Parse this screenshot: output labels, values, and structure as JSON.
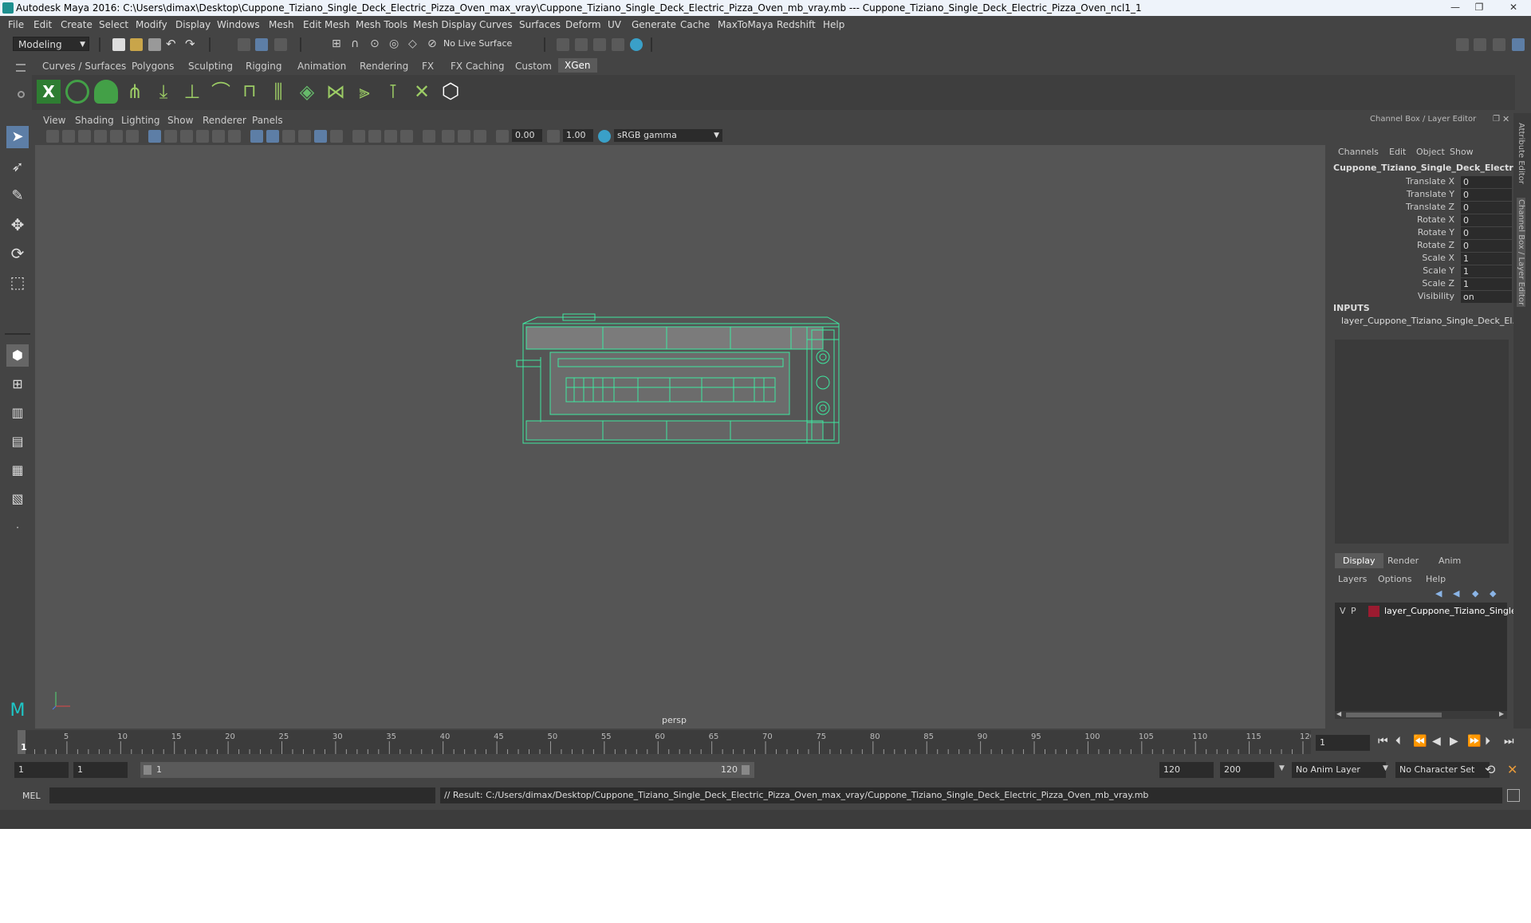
{
  "window": {
    "title": "Autodesk Maya 2016: C:\\Users\\dimax\\Desktop\\Cuppone_Tiziano_Single_Deck_Electric_Pizza_Oven_max_vray\\Cuppone_Tiziano_Single_Deck_Electric_Pizza_Oven_mb_vray.mb   ---   Cuppone_Tiziano_Single_Deck_Electric_Pizza_Oven_ncl1_1",
    "minimize": "—",
    "maximize": "❐",
    "close": "✕"
  },
  "menubar": [
    "File",
    "Edit",
    "Create",
    "Select",
    "Modify",
    "Display",
    "Windows",
    "Mesh",
    "Edit Mesh",
    "Mesh Tools",
    "Mesh Display",
    "Curves",
    "Surfaces",
    "Deform",
    "UV",
    "Generate",
    "Cache",
    "MaxToMaya",
    "Redshift",
    "Help"
  ],
  "statusline": {
    "mode": "Modeling",
    "live_surface": "No Live Surface"
  },
  "shelf_tabs": [
    "Curves / Surfaces",
    "Polygons",
    "Sculpting",
    "Rigging",
    "Animation",
    "Rendering",
    "FX",
    "FX Caching",
    "Custom",
    "XGen"
  ],
  "shelf_active": "XGen",
  "viewport": {
    "menu": [
      "View",
      "Shading",
      "Lighting",
      "Show",
      "Renderer",
      "Panels"
    ],
    "field_a": "0.00",
    "field_b": "1.00",
    "color_space": "sRGB gamma",
    "camera": "persp"
  },
  "channel_box": {
    "header": "Channel Box / Layer Editor",
    "menu": [
      "Channels",
      "Edit",
      "Object",
      "Show"
    ],
    "object_name": "Cuppone_Tiziano_Single_Deck_Electric_P...",
    "attributes": [
      {
        "name": "Translate X",
        "value": "0"
      },
      {
        "name": "Translate Y",
        "value": "0"
      },
      {
        "name": "Translate Z",
        "value": "0"
      },
      {
        "name": "Rotate X",
        "value": "0"
      },
      {
        "name": "Rotate Y",
        "value": "0"
      },
      {
        "name": "Rotate Z",
        "value": "0"
      },
      {
        "name": "Scale X",
        "value": "1"
      },
      {
        "name": "Scale Y",
        "value": "1"
      },
      {
        "name": "Scale Z",
        "value": "1"
      },
      {
        "name": "Visibility",
        "value": "on"
      }
    ],
    "inputs_label": "INPUTS",
    "input_item": "layer_Cuppone_Tiziano_Single_Deck_El...",
    "layer_tabs": [
      "Display",
      "Render",
      "Anim"
    ],
    "layer_tab_active": "Display",
    "layer_menu": [
      "Layers",
      "Options",
      "Help"
    ],
    "layer_row": {
      "v": "V",
      "p": "P",
      "name": "layer_Cuppone_Tiziano_Single_",
      "color": "#9b1b30"
    },
    "side_tabs": [
      "Attribute Editor",
      "Channel Box / Layer Editor"
    ]
  },
  "timeline": {
    "ticks": [
      "5",
      "10",
      "15",
      "20",
      "25",
      "30",
      "35",
      "40",
      "45",
      "50",
      "55",
      "60",
      "65",
      "70",
      "75",
      "80",
      "85",
      "90",
      "95",
      "100",
      "105",
      "110",
      "115",
      "120"
    ],
    "current_marker": "1",
    "current_frame": "1"
  },
  "range": {
    "start": "1",
    "playback_start": "1",
    "slider_start": "1",
    "slider_end": "120",
    "playback_end": "120",
    "end": "200",
    "anim_layer": "No Anim Layer",
    "character_set": "No Character Set"
  },
  "command": {
    "lang": "MEL",
    "result": "// Result: C:/Users/dimax/Desktop/Cuppone_Tiziano_Single_Deck_Electric_Pizza_Oven_max_vray/Cuppone_Tiziano_Single_Deck_Electric_Pizza_Oven_mb_vray.mb"
  },
  "colors": {
    "wireframe": "#3ee8a0",
    "panel": "#444444",
    "viewport": "#555555",
    "accent": "#5d7ea6"
  }
}
